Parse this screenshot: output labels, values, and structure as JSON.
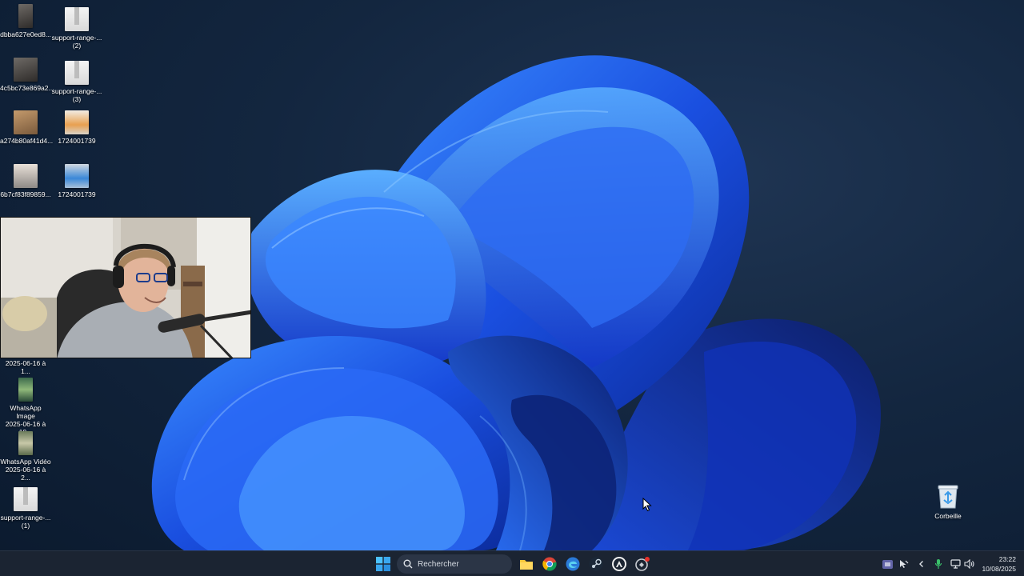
{
  "desktop": {
    "icons": [
      {
        "label": "dbba627e0ed8...",
        "label2": ""
      },
      {
        "label": "support-range-...",
        "label2": "(2)"
      },
      {
        "label": "4c5bc73e869a2...",
        "label2": ""
      },
      {
        "label": "support-range-...",
        "label2": "(3)"
      },
      {
        "label": "a274b80af41d4...",
        "label2": ""
      },
      {
        "label": "1724001739",
        "label2": ""
      },
      {
        "label": "6b7cf83f89859...",
        "label2": ""
      },
      {
        "label": "1724001739",
        "label2": ""
      },
      {
        "label": "2025-06-16 à 1...",
        "label2": ""
      },
      {
        "label": "WhatsApp Image",
        "label2": "2025-06-16 à 19..."
      },
      {
        "label": "WhatsApp Vidéo",
        "label2": "2025-06-16 à 2..."
      },
      {
        "label": "support-range-...",
        "label2": "(1)"
      },
      {
        "label": "Corbeille",
        "label2": ""
      }
    ]
  },
  "taskbar": {
    "search_placeholder": "Rechercher",
    "pinned": [
      {
        "icon": "windows-start-icon"
      },
      {
        "icon": "file-explorer-icon"
      },
      {
        "icon": "chrome-icon"
      },
      {
        "icon": "edge-icon"
      },
      {
        "icon": "steam-icon"
      },
      {
        "icon": "overwatch-icon"
      },
      {
        "icon": "app-with-badge-icon"
      }
    ],
    "tray": [
      "teams-icon",
      "network-cursor-icon",
      "chevron-left-icon",
      "microphone-icon",
      "display-icon",
      "volume-icon"
    ],
    "clock": {
      "time": "23:22",
      "date": "10/08/2025"
    }
  },
  "colors": {
    "taskbar_bg": "#1b2432",
    "wallpaper_blue": "#1f5ce6",
    "wallpaper_bg": "#13263f",
    "accent": "#4cc2ff"
  }
}
